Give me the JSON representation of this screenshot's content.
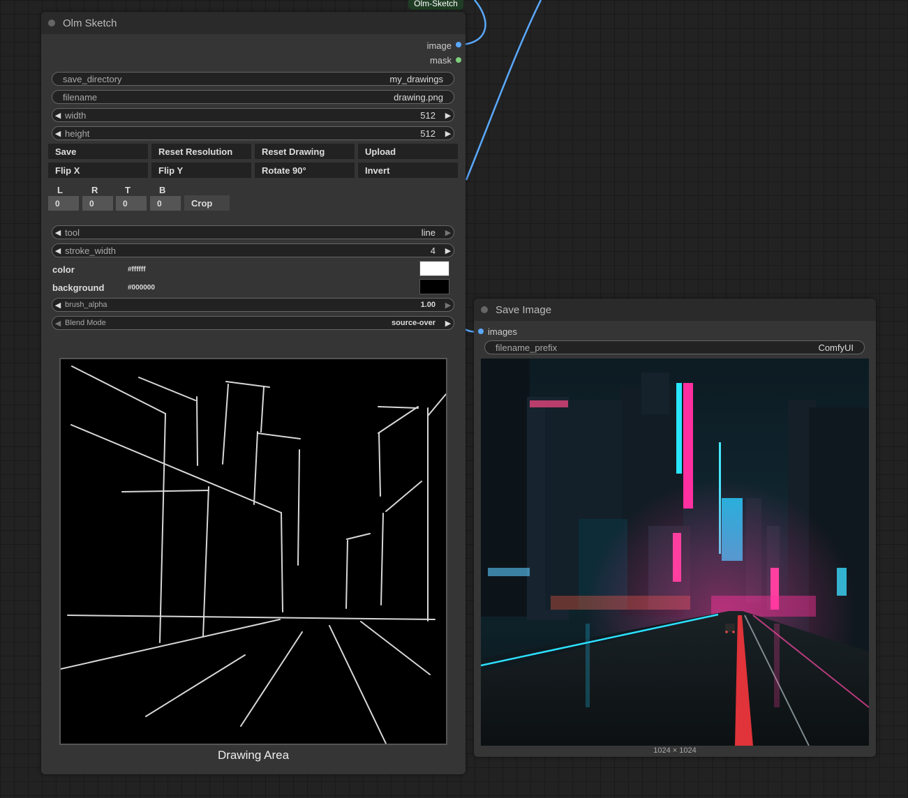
{
  "colors": {
    "link_image": "#5aa9ff",
    "slot_mask": "#7ccf7c",
    "tag_bg": "#1f3d24"
  },
  "top_tag": {
    "label": "Olm-Sketch"
  },
  "sketch_node": {
    "title": "Olm Sketch",
    "outputs": {
      "image": "image",
      "mask": "mask"
    },
    "widgets": {
      "save_directory": {
        "name": "save_directory",
        "value": "my_drawings"
      },
      "filename": {
        "name": "filename",
        "value": "drawing.png"
      },
      "width": {
        "name": "width",
        "value": "512"
      },
      "height": {
        "name": "height",
        "value": "512"
      }
    },
    "buttons": {
      "save": "Save",
      "reset_resolution": "Reset Resolution",
      "reset_drawing": "Reset Drawing",
      "upload": "Upload",
      "flip_x": "Flip X",
      "flip_y": "Flip Y",
      "rotate": "Rotate 90°",
      "invert": "Invert",
      "crop": "Crop"
    },
    "crop": {
      "labels": {
        "l": "L",
        "r": "R",
        "t": "T",
        "b": "B"
      },
      "values": {
        "l": "0",
        "r": "0",
        "t": "0",
        "b": "0"
      }
    },
    "tool": {
      "name": "tool",
      "value": "line"
    },
    "stroke_width": {
      "name": "stroke_width",
      "value": "4"
    },
    "color": {
      "label": "color",
      "value": "#ffffff",
      "display": "#ffffff"
    },
    "background": {
      "label": "background",
      "value": "#000000",
      "display": "#000000"
    },
    "brush_alpha": {
      "name": "brush_alpha",
      "value": "1.00"
    },
    "blend_mode": {
      "name": "Blend Mode",
      "value": "source-over"
    },
    "caption": "Drawing Area"
  },
  "save_node": {
    "title": "Save Image",
    "input": "images",
    "filename_prefix": {
      "name": "filename_prefix",
      "value": "ComfyUI"
    },
    "image_size": "1024 × 1024"
  }
}
